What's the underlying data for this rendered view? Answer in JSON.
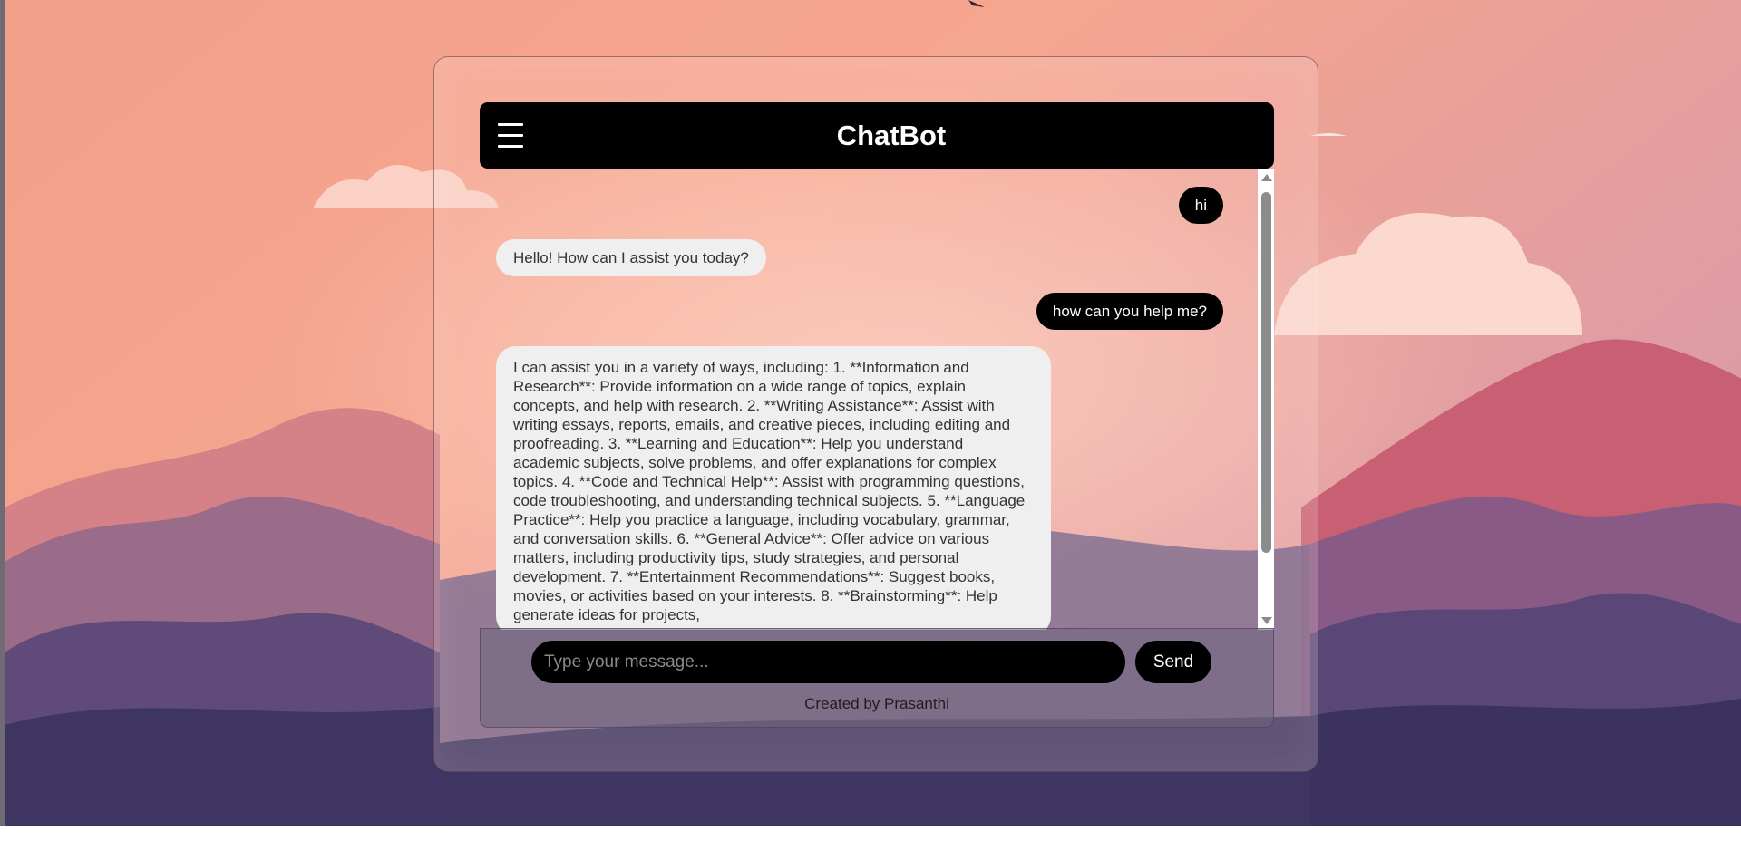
{
  "header": {
    "menu_icon": "hamburger-menu-icon",
    "title": "ChatBot"
  },
  "messages": [
    {
      "role": "user",
      "text": "hi"
    },
    {
      "role": "bot",
      "text": "Hello! How can I assist you today?"
    },
    {
      "role": "user",
      "text": "how can you help me?"
    },
    {
      "role": "bot",
      "text": "I can assist you in a variety of ways, including: 1. **Information and Research**: Provide information on a wide range of topics, explain concepts, and help with research. 2. **Writing Assistance**: Assist with writing essays, reports, emails, and creative pieces, including editing and proofreading. 3. **Learning and Education**: Help you understand academic subjects, solve problems, and offer explanations for complex topics. 4. **Code and Technical Help**: Assist with programming questions, code troubleshooting, and understanding technical subjects. 5. **Language Practice**: Help you practice a language, including vocabulary, grammar, and conversation skills. 6. **General Advice**: Offer advice on various matters, including productivity tips, study strategies, and personal development. 7. **Entertainment Recommendations**: Suggest books, movies, or activities based on your interests. 8. **Brainstorming**: Help generate ideas for projects,"
    }
  ],
  "composer": {
    "placeholder": "Type your message...",
    "send_label": "Send"
  },
  "footer": {
    "credit": "Created by Prasanthi"
  },
  "colors": {
    "header_bg": "#000000",
    "user_bubble": "#000000",
    "bot_bubble": "#efefef",
    "accent_text": "#ffffff"
  }
}
